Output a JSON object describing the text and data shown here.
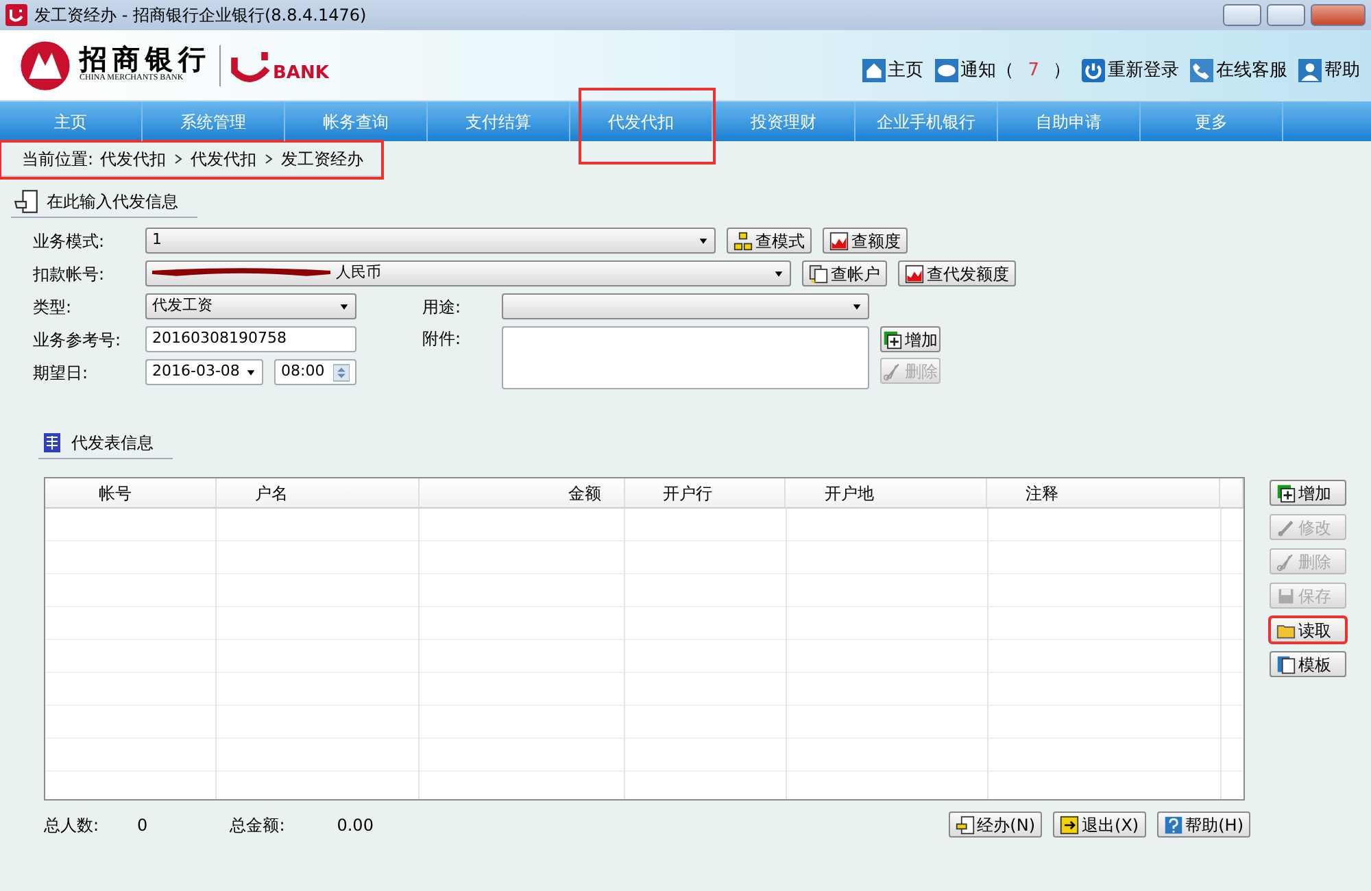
{
  "window": {
    "title": "发工资经办 - 招商银行企业银行(8.8.4.1476)"
  },
  "logo": {
    "name": "招商银行",
    "subtitle": "CHINA MERCHANTS BANK",
    "product": "BANK"
  },
  "top_links": [
    {
      "kind": "home",
      "label": "主页"
    },
    {
      "kind": "notice",
      "label": "通知（",
      "count": "7",
      "suffix": "）"
    },
    {
      "kind": "power",
      "label": "重新登录"
    },
    {
      "kind": "phone",
      "label": "在线客服"
    },
    {
      "kind": "user",
      "label": "帮助"
    }
  ],
  "nav": [
    {
      "label": "主页",
      "highlighted": false
    },
    {
      "label": "系统管理",
      "highlighted": false
    },
    {
      "label": "帐务查询",
      "highlighted": false
    },
    {
      "label": "支付结算",
      "highlighted": false
    },
    {
      "label": "代发代扣",
      "highlighted": true
    },
    {
      "label": "投资理财",
      "highlighted": false
    },
    {
      "label": "企业手机银行",
      "highlighted": false
    },
    {
      "label": "自助申请",
      "highlighted": false
    },
    {
      "label": "更多",
      "highlighted": false
    }
  ],
  "breadcrumb": {
    "label": "当前位置:",
    "items": [
      "代发代扣",
      "代发代扣",
      "发工资经办"
    ],
    "highlighted": true
  },
  "form_section": {
    "title": "在此输入代发信息",
    "mode": {
      "label": "业务模式:",
      "value": "1",
      "buttons": [
        {
          "kind": "mode",
          "label": "查模式"
        },
        {
          "kind": "quota",
          "label": "查额度"
        }
      ]
    },
    "account": {
      "label": "扣款帐号:",
      "value": "人民币",
      "redacted": true,
      "buttons": [
        {
          "kind": "account",
          "label": "查帐户"
        },
        {
          "kind": "quota",
          "label": "查代发额度"
        }
      ]
    },
    "type": {
      "label": "类型:",
      "value": "代发工资"
    },
    "purpose": {
      "label": "用途:"
    },
    "reference": {
      "label": "业务参考号:",
      "value": "20160308190758"
    },
    "attachment": {
      "label": "附件:",
      "buttons": [
        {
          "kind": "add",
          "label": "增加",
          "disabled": false
        },
        {
          "kind": "delete",
          "label": "删除",
          "disabled": true
        }
      ]
    },
    "date": {
      "label": "期望日:",
      "value": "2016-03-08",
      "time": "08:00"
    }
  },
  "table_section": {
    "title": "代发表信息",
    "columns": [
      {
        "label": "帐号"
      },
      {
        "label": "户名"
      },
      {
        "label": "金额"
      },
      {
        "label": "开户行"
      },
      {
        "label": "开户地"
      },
      {
        "label": "注释"
      }
    ],
    "side_buttons": [
      {
        "kind": "add",
        "label": "增加",
        "disabled": false,
        "highlighted": false
      },
      {
        "kind": "edit",
        "label": "修改",
        "disabled": true,
        "highlighted": false
      },
      {
        "kind": "delete",
        "label": "删除",
        "disabled": true,
        "highlighted": false
      },
      {
        "kind": "save",
        "label": "保存",
        "disabled": true,
        "highlighted": false
      },
      {
        "kind": "read",
        "label": "读取",
        "disabled": false,
        "highlighted": true
      },
      {
        "kind": "template",
        "label": "模板",
        "disabled": false,
        "highlighted": false
      }
    ]
  },
  "totals": [
    {
      "label": "总人数:",
      "value": "0"
    },
    {
      "label": "总金额:",
      "value": "0.00"
    }
  ],
  "footer_buttons": [
    {
      "kind": "submit",
      "label": "经办(N)"
    },
    {
      "kind": "exit",
      "label": "退出(X)"
    },
    {
      "kind": "help",
      "label": "帮助(H)"
    }
  ]
}
